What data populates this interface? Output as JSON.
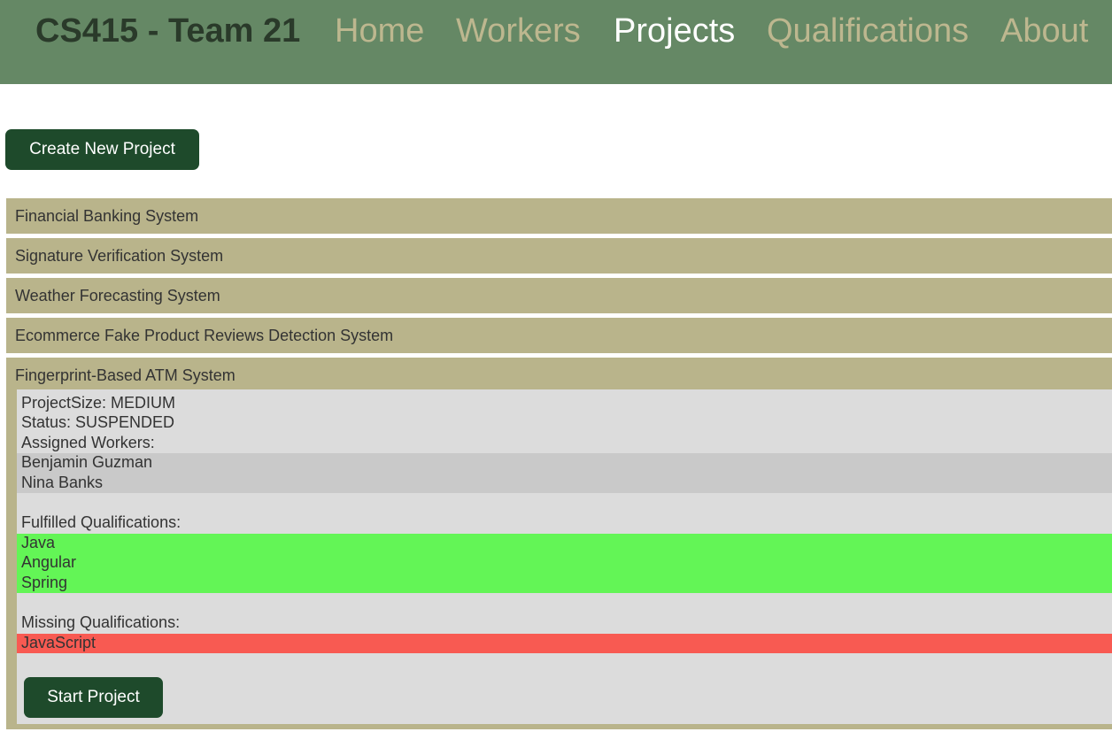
{
  "nav": {
    "brand": "CS415 - Team 21",
    "links": [
      {
        "label": "Home"
      },
      {
        "label": "Workers"
      },
      {
        "label": "Projects",
        "active": true
      },
      {
        "label": "Qualifications"
      },
      {
        "label": "About"
      }
    ]
  },
  "create_button_label": "Create New Project",
  "projects": [
    {
      "name": "Financial Banking System"
    },
    {
      "name": "Signature Verification System"
    },
    {
      "name": "Weather Forecasting System"
    },
    {
      "name": "Ecommerce Fake Product Reviews Detection System"
    },
    {
      "name": "Fingerprint-Based ATM System",
      "expanded": true,
      "size_text": "ProjectSize: MEDIUM",
      "status_text": "Status: SUSPENDED",
      "assigned_label": "Assigned Workers:",
      "workers": [
        "Benjamin Guzman",
        "Nina Banks"
      ],
      "fulfilled_label": "Fulfilled Qualifications:",
      "fulfilled": [
        "Java",
        "Angular",
        "Spring"
      ],
      "missing_label": "Missing Qualifications:",
      "missing": [
        "JavaScript"
      ],
      "start_label": "Start Project"
    }
  ],
  "colors": {
    "nav_bg": "#658865",
    "nav_link": "#bdb78f",
    "nav_active": "#ffffff",
    "button_bg": "#1e4a2b",
    "accordion_bg": "#b9b48b",
    "panel_bg": "#dcdcdc",
    "workers_band": "#c9c9c9",
    "fulfilled_band": "#63f556",
    "missing_band": "#f85a52"
  }
}
